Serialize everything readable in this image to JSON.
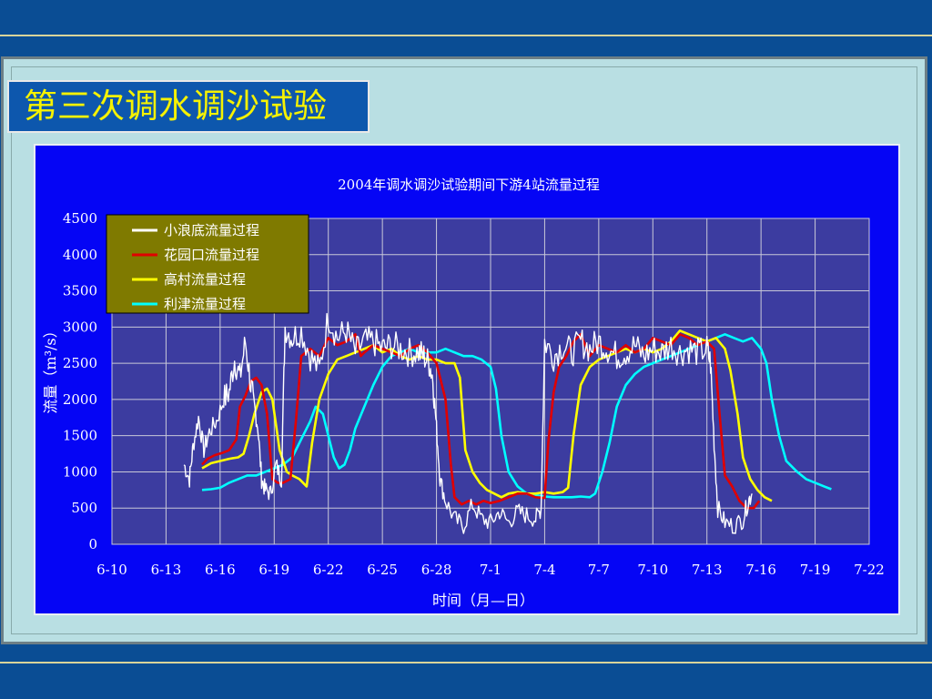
{
  "slide_title": "第三次调水调沙试验",
  "chart_data": {
    "type": "line",
    "title": "2004年调水调沙试验期间下游4站流量过程",
    "xlabel": "时间（月—日）",
    "ylabel": "流量（m³/s）",
    "ylim": [
      0,
      4500
    ],
    "xlim": [
      0,
      42
    ],
    "yticks": [
      0,
      500,
      1000,
      1500,
      2000,
      2500,
      3000,
      3500,
      4000,
      4500
    ],
    "xtick_labels": [
      "6-10",
      "6-13",
      "6-16",
      "6-19",
      "6-22",
      "6-25",
      "6-28",
      "7-1",
      "7-4",
      "7-7",
      "7-10",
      "7-13",
      "7-16",
      "7-19",
      "7-22"
    ],
    "x_unit": "days since 6-10",
    "grid": true,
    "legend_position": "top-left",
    "colors": {
      "slide_bg": "#0a4d94",
      "chart_bg": "#0505f5",
      "plot_bg": "#3c3ca0",
      "legend_bg": "#7f7a00",
      "title_text": "#f6f200"
    },
    "series": [
      {
        "name": "小浪底流量过程",
        "color": "#ffffff",
        "noise": true,
        "points": [
          [
            4,
            1100
          ],
          [
            4.3,
            900
          ],
          [
            4.5,
            1350
          ],
          [
            4.8,
            1750
          ],
          [
            5.1,
            1300
          ],
          [
            5.4,
            1550
          ],
          [
            5.8,
            1700
          ],
          [
            6.2,
            2000
          ],
          [
            6.5,
            2100
          ],
          [
            6.8,
            2550
          ],
          [
            7.1,
            2300
          ],
          [
            7.4,
            2800
          ],
          [
            7.7,
            2200
          ],
          [
            7.9,
            1900
          ],
          [
            8.1,
            1600
          ],
          [
            8.3,
            900
          ],
          [
            8.5,
            750
          ],
          [
            8.8,
            700
          ],
          [
            9.1,
            1100
          ],
          [
            9.4,
            900
          ],
          [
            9.6,
            3000
          ],
          [
            10,
            2850
          ],
          [
            10.5,
            2950
          ],
          [
            11,
            2600
          ],
          [
            11.5,
            2400
          ],
          [
            12,
            3150
          ],
          [
            12.5,
            2850
          ],
          [
            13,
            2950
          ],
          [
            13.5,
            2650
          ],
          [
            14,
            2800
          ],
          [
            14.5,
            2800
          ],
          [
            15,
            2700
          ],
          [
            15.5,
            2750
          ],
          [
            16,
            2700
          ],
          [
            16.5,
            2650
          ],
          [
            17,
            2650
          ],
          [
            17.3,
            2600
          ],
          [
            17.6,
            2500
          ],
          [
            17.8,
            2300
          ],
          [
            18,
            1600
          ],
          [
            18.2,
            900
          ],
          [
            18.5,
            600
          ],
          [
            19,
            350
          ],
          [
            19.5,
            250
          ],
          [
            20,
            550
          ],
          [
            20.5,
            350
          ],
          [
            21,
            300
          ],
          [
            21.5,
            450
          ],
          [
            22,
            300
          ],
          [
            22.5,
            450
          ],
          [
            23,
            400
          ],
          [
            23.5,
            350
          ],
          [
            23.8,
            500
          ],
          [
            24,
            2800
          ],
          [
            24.5,
            2600
          ],
          [
            25,
            2750
          ],
          [
            25.5,
            2650
          ],
          [
            26,
            2800
          ],
          [
            26.5,
            2700
          ],
          [
            27,
            2800
          ],
          [
            27.5,
            2700
          ],
          [
            28,
            2600
          ],
          [
            28.5,
            2650
          ],
          [
            29,
            2750
          ],
          [
            29.5,
            2600
          ],
          [
            30,
            2700
          ],
          [
            30.5,
            2650
          ],
          [
            31,
            2750
          ],
          [
            31.5,
            2650
          ],
          [
            32,
            2700
          ],
          [
            32.5,
            2650
          ],
          [
            33,
            2700
          ],
          [
            33.2,
            2500
          ],
          [
            33.4,
            1400
          ],
          [
            33.6,
            500
          ],
          [
            34,
            300
          ],
          [
            34.5,
            250
          ],
          [
            35,
            350
          ],
          [
            35.3,
            600
          ],
          [
            35.5,
            700
          ]
        ]
      },
      {
        "name": "花园口流量过程",
        "color": "#e00000",
        "noise": false,
        "points": [
          [
            5,
            1100
          ],
          [
            5.3,
            1180
          ],
          [
            5.7,
            1230
          ],
          [
            6.1,
            1260
          ],
          [
            6.5,
            1300
          ],
          [
            6.9,
            1450
          ],
          [
            7.1,
            1900
          ],
          [
            7.4,
            2050
          ],
          [
            7.7,
            2250
          ],
          [
            8,
            2300
          ],
          [
            8.3,
            2200
          ],
          [
            8.6,
            1800
          ],
          [
            8.9,
            900
          ],
          [
            9.2,
            850
          ],
          [
            9.5,
            850
          ],
          [
            9.9,
            900
          ],
          [
            10.2,
            1700
          ],
          [
            10.5,
            2600
          ],
          [
            11,
            2700
          ],
          [
            11.5,
            2600
          ],
          [
            12,
            2850
          ],
          [
            12.5,
            2750
          ],
          [
            13,
            2800
          ],
          [
            13.5,
            2900
          ],
          [
            13.8,
            2600
          ],
          [
            14,
            2650
          ],
          [
            14.5,
            2750
          ],
          [
            15,
            2700
          ],
          [
            15.5,
            2650
          ],
          [
            16,
            2600
          ],
          [
            16.5,
            2700
          ],
          [
            17,
            2750
          ],
          [
            17.5,
            2650
          ],
          [
            18,
            2500
          ],
          [
            18.5,
            2000
          ],
          [
            18.8,
            1100
          ],
          [
            19,
            650
          ],
          [
            19.4,
            550
          ],
          [
            19.8,
            600
          ],
          [
            20.2,
            550
          ],
          [
            20.6,
            600
          ],
          [
            21,
            570
          ],
          [
            21.5,
            600
          ],
          [
            22,
            650
          ],
          [
            22.5,
            700
          ],
          [
            23,
            700
          ],
          [
            23.5,
            650
          ],
          [
            24,
            640
          ],
          [
            24.2,
            1400
          ],
          [
            24.5,
            2100
          ],
          [
            24.8,
            2450
          ],
          [
            25.2,
            2600
          ],
          [
            25.6,
            2800
          ],
          [
            26,
            2900
          ],
          [
            26.5,
            2600
          ],
          [
            27,
            2750
          ],
          [
            27.5,
            2700
          ],
          [
            28,
            2650
          ],
          [
            28.5,
            2750
          ],
          [
            29,
            2650
          ],
          [
            29.5,
            2700
          ],
          [
            30,
            2850
          ],
          [
            30.5,
            2800
          ],
          [
            31,
            2750
          ],
          [
            31.5,
            2900
          ],
          [
            32,
            2850
          ],
          [
            32.5,
            2750
          ],
          [
            33,
            2800
          ],
          [
            33.4,
            2700
          ],
          [
            33.7,
            1800
          ],
          [
            34,
            950
          ],
          [
            34.4,
            800
          ],
          [
            34.8,
            600
          ],
          [
            35.2,
            500
          ],
          [
            35.6,
            500
          ],
          [
            35.9,
            600
          ]
        ]
      },
      {
        "name": "高村流量过程",
        "color": "#ffff00",
        "noise": false,
        "points": [
          [
            5,
            1050
          ],
          [
            5.5,
            1120
          ],
          [
            6,
            1150
          ],
          [
            6.5,
            1180
          ],
          [
            7,
            1200
          ],
          [
            7.3,
            1250
          ],
          [
            7.6,
            1500
          ],
          [
            7.9,
            1800
          ],
          [
            8.3,
            2100
          ],
          [
            8.6,
            2150
          ],
          [
            8.9,
            2000
          ],
          [
            9.3,
            1300
          ],
          [
            9.7,
            1000
          ],
          [
            10,
            950
          ],
          [
            10.4,
            900
          ],
          [
            10.8,
            800
          ],
          [
            11.1,
            1400
          ],
          [
            11.5,
            2000
          ],
          [
            12,
            2350
          ],
          [
            12.5,
            2550
          ],
          [
            13,
            2600
          ],
          [
            13.5,
            2650
          ],
          [
            14,
            2700
          ],
          [
            14.5,
            2750
          ],
          [
            15,
            2650
          ],
          [
            15.5,
            2700
          ],
          [
            16,
            2600
          ],
          [
            16.5,
            2550
          ],
          [
            17,
            2600
          ],
          [
            17.5,
            2550
          ],
          [
            18,
            2550
          ],
          [
            18.5,
            2500
          ],
          [
            19,
            2500
          ],
          [
            19.3,
            2300
          ],
          [
            19.6,
            1300
          ],
          [
            20,
            1000
          ],
          [
            20.4,
            850
          ],
          [
            20.8,
            750
          ],
          [
            21.2,
            700
          ],
          [
            21.6,
            650
          ],
          [
            22,
            700
          ],
          [
            22.5,
            720
          ],
          [
            23,
            700
          ],
          [
            23.5,
            700
          ],
          [
            24,
            720
          ],
          [
            24.5,
            700
          ],
          [
            25,
            720
          ],
          [
            25.3,
            780
          ],
          [
            25.6,
            1500
          ],
          [
            26,
            2200
          ],
          [
            26.5,
            2450
          ],
          [
            27,
            2550
          ],
          [
            27.5,
            2600
          ],
          [
            28,
            2650
          ],
          [
            28.5,
            2700
          ],
          [
            29,
            2650
          ],
          [
            29.5,
            2700
          ],
          [
            30,
            2650
          ],
          [
            30.5,
            2700
          ],
          [
            31,
            2800
          ],
          [
            31.5,
            2950
          ],
          [
            32,
            2900
          ],
          [
            32.5,
            2850
          ],
          [
            33,
            2800
          ],
          [
            33.5,
            2850
          ],
          [
            34,
            2700
          ],
          [
            34.3,
            2400
          ],
          [
            34.7,
            1800
          ],
          [
            35,
            1200
          ],
          [
            35.4,
            900
          ],
          [
            35.8,
            750
          ],
          [
            36.2,
            650
          ],
          [
            36.6,
            600
          ]
        ]
      },
      {
        "name": "利津流量过程",
        "color": "#00ffff",
        "noise": false,
        "points": [
          [
            5,
            750
          ],
          [
            5.5,
            760
          ],
          [
            6,
            780
          ],
          [
            6.5,
            850
          ],
          [
            7,
            900
          ],
          [
            7.5,
            950
          ],
          [
            8,
            950
          ],
          [
            8.5,
            1000
          ],
          [
            9,
            1050
          ],
          [
            9.5,
            1100
          ],
          [
            10,
            1200
          ],
          [
            10.5,
            1450
          ],
          [
            11,
            1700
          ],
          [
            11.3,
            1900
          ],
          [
            11.7,
            1800
          ],
          [
            12,
            1500
          ],
          [
            12.3,
            1200
          ],
          [
            12.6,
            1050
          ],
          [
            12.9,
            1100
          ],
          [
            13.2,
            1300
          ],
          [
            13.5,
            1600
          ],
          [
            14,
            1900
          ],
          [
            14.5,
            2200
          ],
          [
            15,
            2450
          ],
          [
            15.5,
            2600
          ],
          [
            16,
            2650
          ],
          [
            16.5,
            2700
          ],
          [
            17,
            2650
          ],
          [
            17.5,
            2650
          ],
          [
            18,
            2650
          ],
          [
            18.5,
            2700
          ],
          [
            19,
            2650
          ],
          [
            19.5,
            2600
          ],
          [
            20,
            2600
          ],
          [
            20.5,
            2550
          ],
          [
            21,
            2450
          ],
          [
            21.3,
            2150
          ],
          [
            21.6,
            1500
          ],
          [
            22,
            1000
          ],
          [
            22.5,
            800
          ],
          [
            23,
            700
          ],
          [
            23.5,
            680
          ],
          [
            24,
            660
          ],
          [
            24.5,
            650
          ],
          [
            25,
            650
          ],
          [
            25.5,
            650
          ],
          [
            26,
            660
          ],
          [
            26.5,
            650
          ],
          [
            26.8,
            700
          ],
          [
            27.2,
            1000
          ],
          [
            27.6,
            1400
          ],
          [
            28,
            1900
          ],
          [
            28.5,
            2200
          ],
          [
            29,
            2350
          ],
          [
            29.5,
            2450
          ],
          [
            30,
            2500
          ],
          [
            30.5,
            2550
          ],
          [
            31,
            2600
          ],
          [
            31.5,
            2650
          ],
          [
            32,
            2700
          ],
          [
            32.5,
            2750
          ],
          [
            33,
            2800
          ],
          [
            33.5,
            2850
          ],
          [
            34,
            2900
          ],
          [
            34.5,
            2850
          ],
          [
            35,
            2800
          ],
          [
            35.5,
            2850
          ],
          [
            36,
            2700
          ],
          [
            36.3,
            2500
          ],
          [
            36.6,
            2000
          ],
          [
            37,
            1500
          ],
          [
            37.4,
            1150
          ],
          [
            38,
            1000
          ],
          [
            38.5,
            900
          ],
          [
            39,
            850
          ],
          [
            39.5,
            800
          ],
          [
            39.9,
            760
          ]
        ]
      }
    ]
  }
}
